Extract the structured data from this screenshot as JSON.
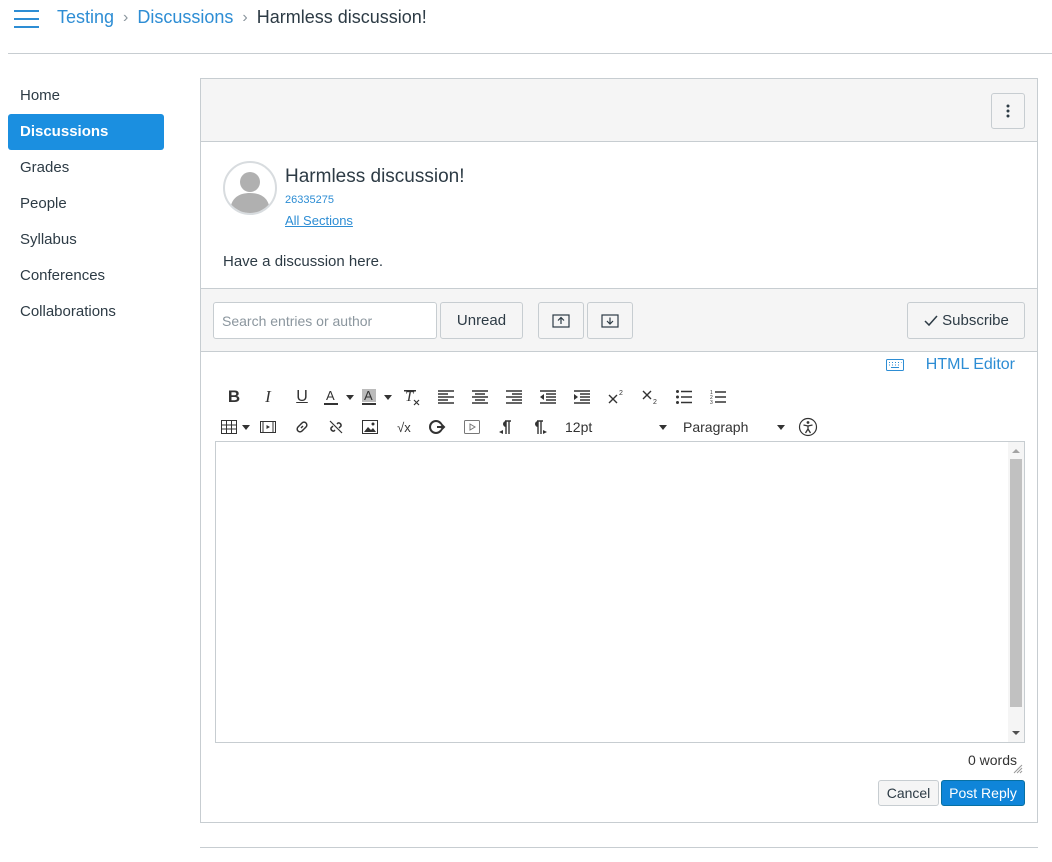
{
  "breadcrumb": {
    "course": "Testing",
    "section": "Discussions",
    "current": "Harmless discussion!"
  },
  "nav": {
    "items": [
      {
        "label": "Home",
        "active": false
      },
      {
        "label": "Discussions",
        "active": true
      },
      {
        "label": "Grades",
        "active": false
      },
      {
        "label": "People",
        "active": false
      },
      {
        "label": "Syllabus",
        "active": false
      },
      {
        "label": "Conferences",
        "active": false
      },
      {
        "label": "Collaborations",
        "active": false
      }
    ]
  },
  "discussion": {
    "title": "Harmless discussion!",
    "author_id": "26335275",
    "sections_link": "All Sections",
    "body": "Have a discussion here."
  },
  "toolbar": {
    "search_placeholder": "Search entries or author",
    "unread_label": "Unread",
    "subscribe_label": "Subscribe"
  },
  "editor": {
    "html_editor_label": "HTML Editor",
    "font_size": "12pt",
    "block_format": "Paragraph",
    "word_count": "0 words",
    "cancel_label": "Cancel",
    "post_label": "Post Reply"
  },
  "colors": {
    "link": "#2d8dd4",
    "active_nav": "#1b8fe0",
    "primary_button": "#0f85d9"
  }
}
